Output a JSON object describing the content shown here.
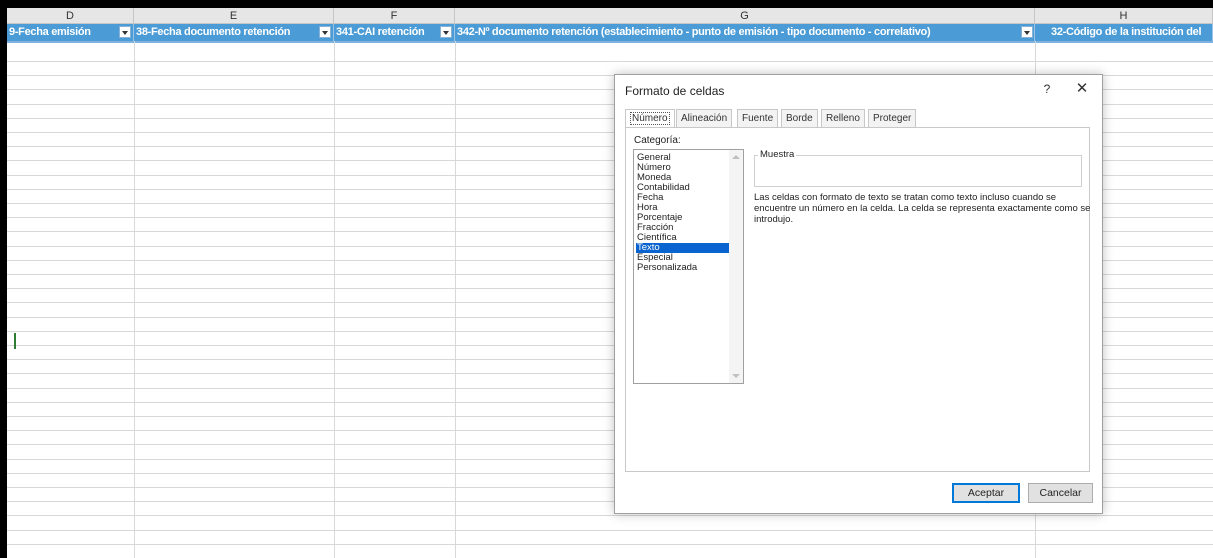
{
  "sheet": {
    "columns": [
      {
        "letter": "D",
        "header": "9-Fecha emisión"
      },
      {
        "letter": "E",
        "header": "38-Fecha documento retención"
      },
      {
        "letter": "F",
        "header": "341-CAI retención"
      },
      {
        "letter": "G",
        "header": "342-Nº documento retención (establecimiento - punto de emisión - tipo documento - correlativo)"
      },
      {
        "letter": "H",
        "header": "32-Código de la institución del"
      }
    ]
  },
  "dialog": {
    "title": "Formato de celdas",
    "help": "?",
    "close": "✕",
    "tabs": [
      "Número",
      "Alineación",
      "Fuente",
      "Borde",
      "Relleno",
      "Proteger"
    ],
    "category_label": "Categoría:",
    "categories": [
      "General",
      "Número",
      "Moneda",
      "Contabilidad",
      "Fecha",
      "Hora",
      "Porcentaje",
      "Fracción",
      "Científica",
      "Texto",
      "Especial",
      "Personalizada"
    ],
    "selected_category": "Texto",
    "sample_label": "Muestra",
    "description": "Las celdas con formato de texto se tratan como texto incluso cuando se encuentre un número en la celda. La celda se representa exactamente como se introdujo.",
    "ok_label": "Aceptar",
    "cancel_label": "Cancelar"
  },
  "colors": {
    "header_bg": "#4a9bd6",
    "selection": "#0a64d0",
    "accent_border": "#0078d7"
  }
}
